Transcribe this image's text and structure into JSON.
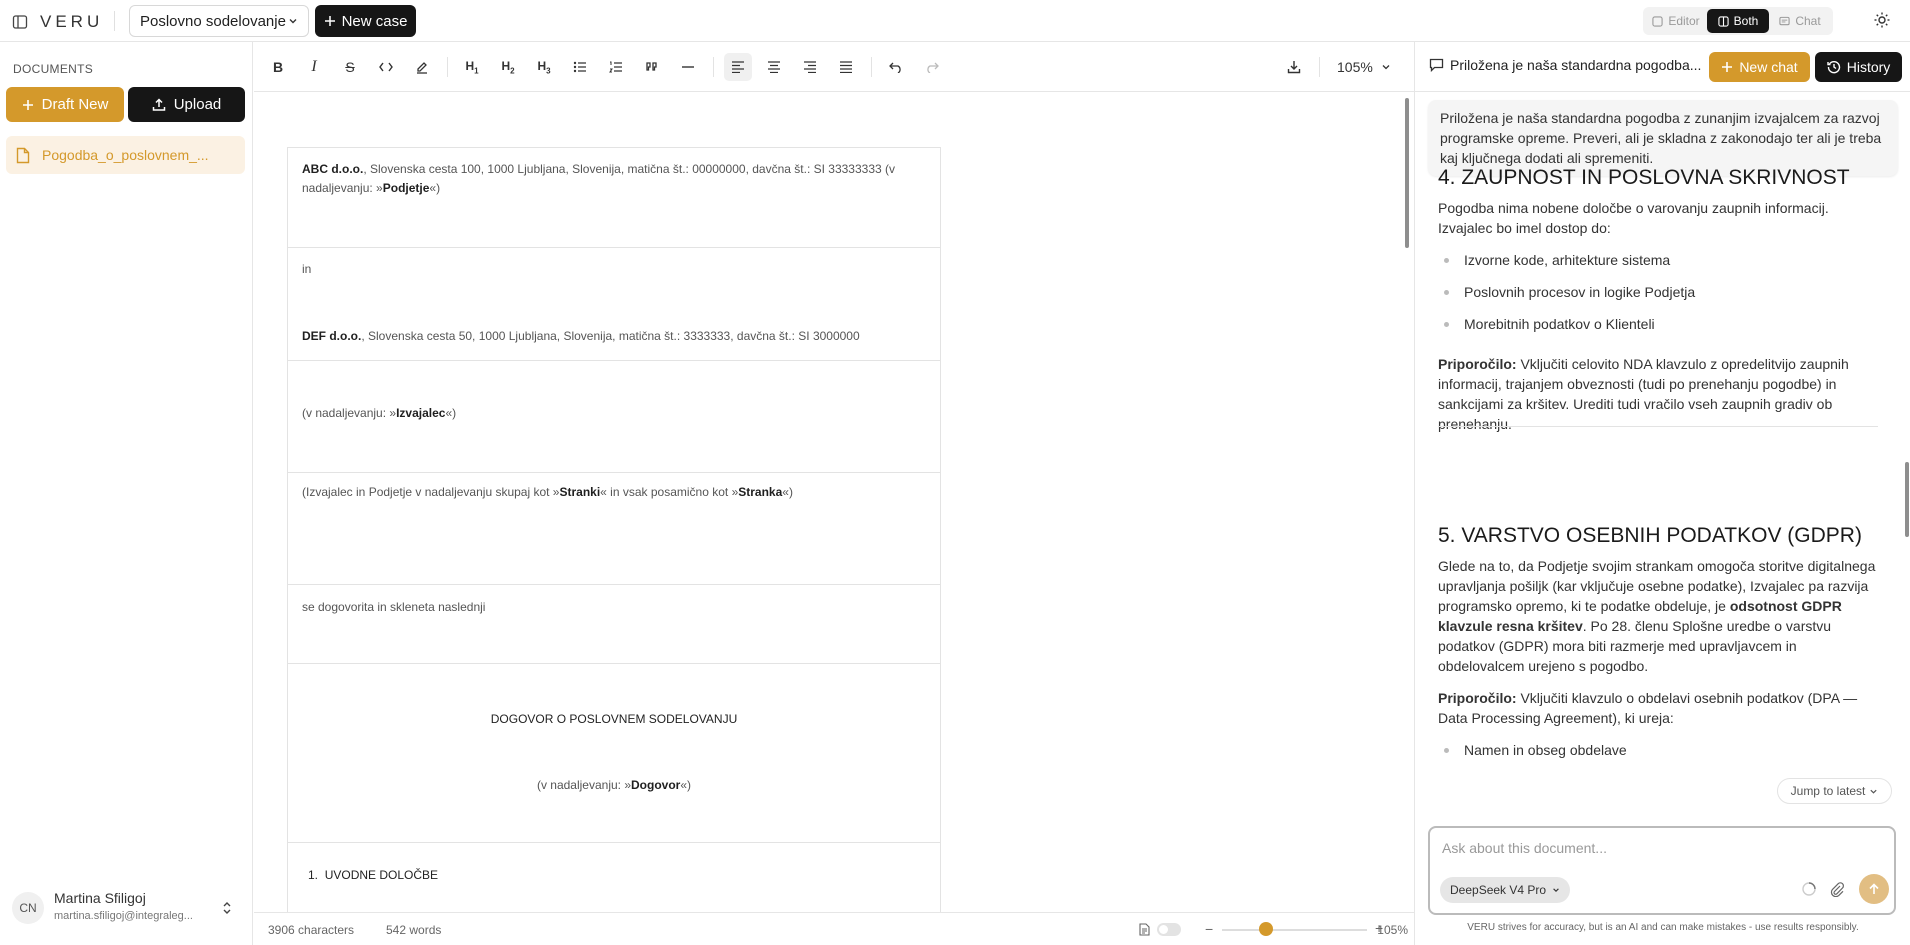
{
  "app": {
    "name": "VERU"
  },
  "topbar": {
    "case_select": "Poslovno sodelovanje",
    "new_case": "New case",
    "modes": [
      {
        "label": "Editor",
        "active": false
      },
      {
        "label": "Both",
        "active": true
      },
      {
        "label": "Chat",
        "active": false
      }
    ],
    "theme_icon": "sun-icon"
  },
  "sidebar": {
    "section_title": "DOCUMENTS",
    "draft_new": "Draft New",
    "upload": "Upload",
    "documents": [
      {
        "label": "Pogodba_o_poslovnem_..."
      }
    ],
    "user": {
      "initials": "CN",
      "name": "Martina Sfiligoj",
      "email": "martina.sfiligoj@integraleg..."
    }
  },
  "toolbar": {
    "zoom": "105%"
  },
  "document": {
    "cells": {
      "c1_name": "ABC d.o.o.",
      "c1_text": ", Slovenska cesta 100, 1000 Ljubljana, Slovenija, matična št.: 00000000, davčna št.: SI 33333333 (v nadaljevanju: »",
      "c1_bold": "Podjetje",
      "c1_end": "«)",
      "c2_in": "in",
      "c2_name": "DEF d.o.o.",
      "c2_text": ", Slovenska cesta 50, 1000 Ljubljana, Slovenija, matična št.: 3333333, davčna št.: SI 3000000",
      "c3_text": "(v nadaljevanju: »",
      "c3_bold": "Izvajalec",
      "c3_end": "«)",
      "c4_a": "(Izvajalec in Podjetje v nadaljevanju skupaj kot »",
      "c4_b": "Stranki",
      "c4_c": "« in vsak posamično kot »",
      "c4_d": "Stranka",
      "c4_e": "«)",
      "c5_text": "se dogovorita in skleneta naslednji",
      "c6_title": "DOGOVOR O POSLOVNEM SODELOVANJU",
      "c6_sub_a": "(v nadaljevanju: »",
      "c6_sub_b": "Dogovor",
      "c6_sub_c": "«)",
      "c7_num": "1.",
      "c7_text": "UVODNE DOLOČBE"
    }
  },
  "statusbar": {
    "characters": "3906 characters",
    "words": "542 words",
    "zoom": "105%"
  },
  "chat": {
    "title": "Priložena je naša standardna pogodba...",
    "new_chat": "New chat",
    "history": "History",
    "user_message": "Priložena je naša standardna pogodba z zunanjim izvajalcem za razvoj programske opreme. Preveri, ali je skladna z zakonodajo ter ali je treba kaj ključnega dodati ali spremeniti.",
    "section4": {
      "heading": "4. ZAUPNOST IN POSLOVNA SKRIVNOST",
      "intro": "Pogodba nima nobene določbe o varovanju zaupnih informacij. Izvajalec bo imel dostop do:",
      "items": [
        "Izvorne kode, arhitekture sistema",
        "Poslovnih procesov in logike Podjetja",
        "Morebitnih podatkov o Klienteli"
      ],
      "rec_label": "Priporočilo:",
      "rec_text": " Vključiti celovito NDA klavzulo z opredelitvijo zaupnih informacij, trajanjem obveznosti (tudi po prenehanju pogodbe) in sankcijami za kršitev. Urediti tudi vračilo vseh zaupnih gradiv ob prenehanju."
    },
    "section5": {
      "heading": "5. VARSTVO OSEBNIH PODATKOV (GDPR)",
      "p1_a": "Glede na to, da Podjetje svojim strankam omogoča storitve digitalnega upravljanja pošiljk (kar vključuje osebne podatke), Izvajalec pa razvija programsko opremo, ki te podatke obdeluje, je ",
      "p1_bold": "odsotnost GDPR klavzule resna kršitev",
      "p1_b": ". Po 28. členu Splošne uredbe o varstvu podatkov (GDPR) mora biti razmerje med upravljavcem in obdelovalcem urejeno s pogodbo.",
      "rec_label": "Priporočilo:",
      "rec_text": " Vključiti klavzulo o obdelavi osebnih podatkov (DPA — Data Processing Agreement), ki ureja:",
      "items": [
        "Namen in obseg obdelave"
      ]
    },
    "jump_latest": "Jump to latest",
    "input_placeholder": "Ask about this document...",
    "model": "DeepSeek V4 Pro",
    "disclaimer": "VERU strives for accuracy, but is an AI and can make mistakes - use results responsibly."
  }
}
